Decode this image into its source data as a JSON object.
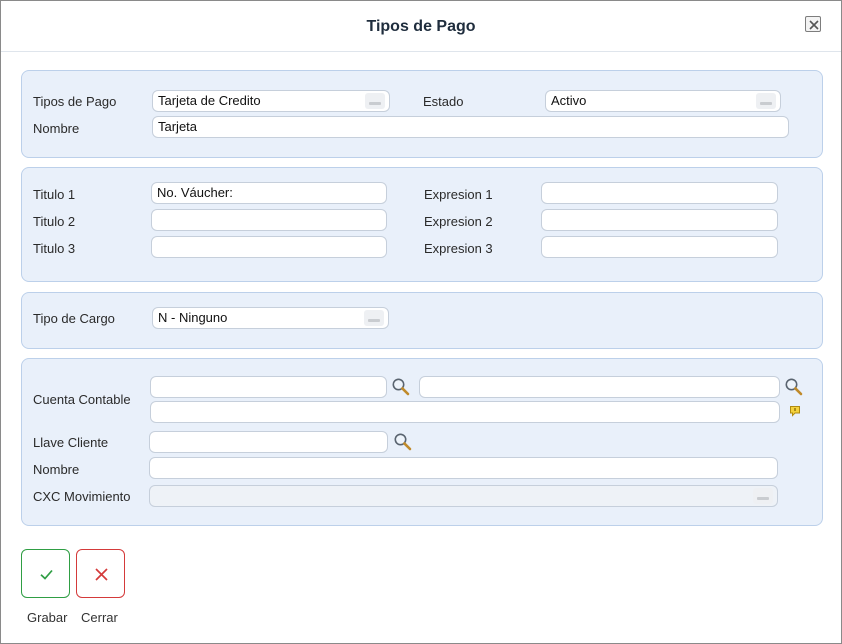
{
  "dialog": {
    "title": "Tipos de Pago"
  },
  "section1": {
    "tipos_pago_label": "Tipos de Pago",
    "tipos_pago_value": "Tarjeta de Credito",
    "estado_label": "Estado",
    "estado_value": "Activo",
    "nombre_label": "Nombre",
    "nombre_value": "Tarjeta"
  },
  "section2": {
    "titulo1_label": "Titulo 1",
    "titulo1_value": "No. Váucher:",
    "titulo2_label": "Titulo 2",
    "titulo2_value": "",
    "titulo3_label": "Titulo 3",
    "titulo3_value": "",
    "expresion1_label": "Expresion 1",
    "expresion1_value": "",
    "expresion2_label": "Expresion 2",
    "expresion2_value": "",
    "expresion3_label": "Expresion 3",
    "expresion3_value": ""
  },
  "section3": {
    "tipo_cargo_label": "Tipo de Cargo",
    "tipo_cargo_value": "N - Ninguno"
  },
  "section4": {
    "cuenta_contable_label": "Cuenta Contable",
    "cuenta_code_value": "",
    "cuenta_name_value": "",
    "cuenta_desc_value": "",
    "llave_cliente_label": "Llave Cliente",
    "llave_cliente_value": "",
    "nombre_label": "Nombre",
    "nombre_value": "",
    "cxc_movimiento_label": "CXC Movimiento",
    "cxc_movimiento_value": ""
  },
  "actions": {
    "save_label": "Grabar",
    "close_label": "Cerrar"
  },
  "colors": {
    "panel_bg": "#e9f0fa",
    "panel_border": "#bcd0ea",
    "save_accent": "#2f9e44",
    "close_accent": "#d43a3a"
  },
  "icons": {
    "lookup": "magnifier-icon",
    "note": "note-icon",
    "dropdown": "dropdown-arrow-icon",
    "close": "close-icon"
  }
}
